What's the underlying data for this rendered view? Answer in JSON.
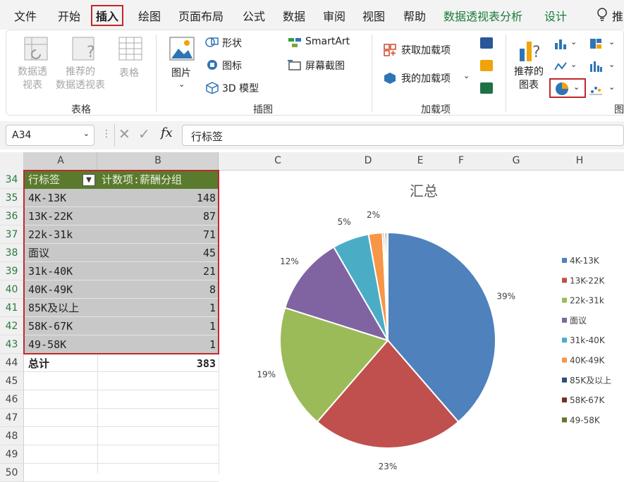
{
  "menu": {
    "tabs": [
      "文件",
      "开始",
      "插入",
      "绘图",
      "页面布局",
      "公式",
      "数据",
      "审阅",
      "视图",
      "帮助"
    ],
    "context_tabs": [
      "数据透视表分析",
      "设计"
    ],
    "search_icon": "lightbulb-icon"
  },
  "ribbon": {
    "tables": {
      "pivot": "数据透\n视表",
      "recommended_pivot": "推荐的\n数据透视表",
      "table": "表格",
      "group_label": "表格"
    },
    "illustrations": {
      "picture": "图片",
      "shapes": "形状",
      "icons": "图标",
      "models3d": "3D 模型",
      "smartart": "SmartArt",
      "screenshot": "屏幕截图",
      "group_label": "插图"
    },
    "addins": {
      "get": "获取加载项",
      "mine": "我的加载项",
      "group_label": "加载项"
    },
    "charts": {
      "recommended": "推荐的\n图表",
      "group_label": "图"
    },
    "partial_right": "推"
  },
  "formula_bar": {
    "name_box": "A34",
    "formula": "行标签"
  },
  "columns": [
    "A",
    "B",
    "C",
    "D",
    "E",
    "F",
    "G",
    "H"
  ],
  "rows": [
    34,
    35,
    36,
    37,
    38,
    39,
    40,
    41,
    42,
    43,
    44,
    45,
    46,
    47,
    48,
    49,
    50
  ],
  "pivot": {
    "header_left": "行标签",
    "header_right": "计数项:薪酬分组",
    "items": [
      {
        "label": "4K-13K",
        "count": 148
      },
      {
        "label": "13K-22K",
        "count": 87
      },
      {
        "label": "22k-31k",
        "count": 71
      },
      {
        "label": "面议",
        "count": 45
      },
      {
        "label": "31k-40K",
        "count": 21
      },
      {
        "label": "40K-49K",
        "count": 8
      },
      {
        "label": "85K及以上",
        "count": 1
      },
      {
        "label": "58K-67K",
        "count": 1
      },
      {
        "label": "49-58K",
        "count": 1
      }
    ],
    "total_label": "总计",
    "total_value": 383
  },
  "chart_data": {
    "type": "pie",
    "title": "汇总",
    "categories": [
      "4K-13K",
      "13K-22K",
      "22k-31k",
      "面议",
      "31k-40K",
      "40K-49K",
      "85K及以上",
      "58K-67K",
      "49-58K"
    ],
    "values": [
      148,
      87,
      71,
      45,
      21,
      8,
      1,
      1,
      1
    ],
    "slice_labels": [
      "39%",
      "23%",
      "19%",
      "12%",
      "5%",
      "2%",
      "",
      "",
      ""
    ],
    "colors": [
      "#4f81bd",
      "#c0504d",
      "#9bbb59",
      "#8064a2",
      "#4bacc6",
      "#f79646",
      "#2c4d75",
      "#772c2a",
      "#5f7530"
    ],
    "legend": "right"
  },
  "accent": "#c0282d",
  "pivot_header_color": "#5a7a2e"
}
